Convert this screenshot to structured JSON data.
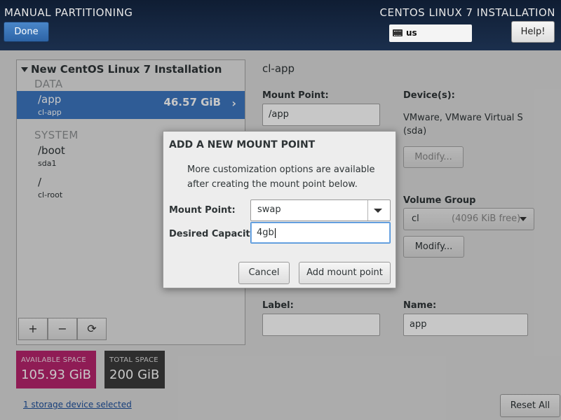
{
  "header": {
    "title": "MANUAL PARTITIONING",
    "product": "CENTOS LINUX 7 INSTALLATION",
    "done_label": "Done",
    "keyboard_layout": "us",
    "help_label": "Help!"
  },
  "left_panel": {
    "installation_title": "New CentOS Linux 7 Installation",
    "sections": {
      "data_label": "DATA",
      "system_label": "SYSTEM"
    },
    "data_items": [
      {
        "mount_point": "/app",
        "device": "cl-app",
        "size": "46.57 GiB",
        "selected": true
      }
    ],
    "system_items": [
      {
        "mount_point": "/boot",
        "device": "sda1"
      },
      {
        "mount_point": "/",
        "device": "cl-root"
      }
    ],
    "toolbar": {
      "add": "+",
      "remove": "−",
      "refresh": "⟳"
    }
  },
  "space": {
    "available_label": "AVAILABLE SPACE",
    "available_value": "105.93 GiB",
    "total_label": "TOTAL SPACE",
    "total_value": "200 GiB"
  },
  "storage_link": "1 storage device selected",
  "reset_label": "Reset All",
  "details": {
    "heading": "cl-app",
    "mount_point_label": "Mount Point:",
    "mount_point_value": "/app",
    "devices_label": "Device(s):",
    "devices_value_line1": "VMware, VMware Virtual S",
    "devices_value_line2": "(sda)",
    "modify_label": "Modify...",
    "volume_group_label": "Volume Group",
    "volume_group_name": "cl",
    "volume_group_free": "(4096 KiB free)",
    "vg_modify_label": "Modify...",
    "label_label": "Label:",
    "label_value": "",
    "name_label": "Name:",
    "name_value": "app"
  },
  "dialog": {
    "title": "ADD A NEW MOUNT POINT",
    "message": "More customization options are available after creating the mount point below.",
    "mount_point_label": "Mount Point:",
    "mount_point_value": "swap",
    "capacity_label": "Desired Capacity:",
    "capacity_value": "4gb",
    "cancel_label": "Cancel",
    "add_label": "Add mount point"
  },
  "colors": {
    "header_bg": "#13243e",
    "selected_row": "#3d77c1",
    "available_space": "#b8246d",
    "total_space": "#3b3b3b"
  },
  "icons": [
    "expander-icon",
    "chevron-right-icon",
    "keyboard-icon",
    "dropdown-arrow-icon",
    "refresh-icon"
  ]
}
